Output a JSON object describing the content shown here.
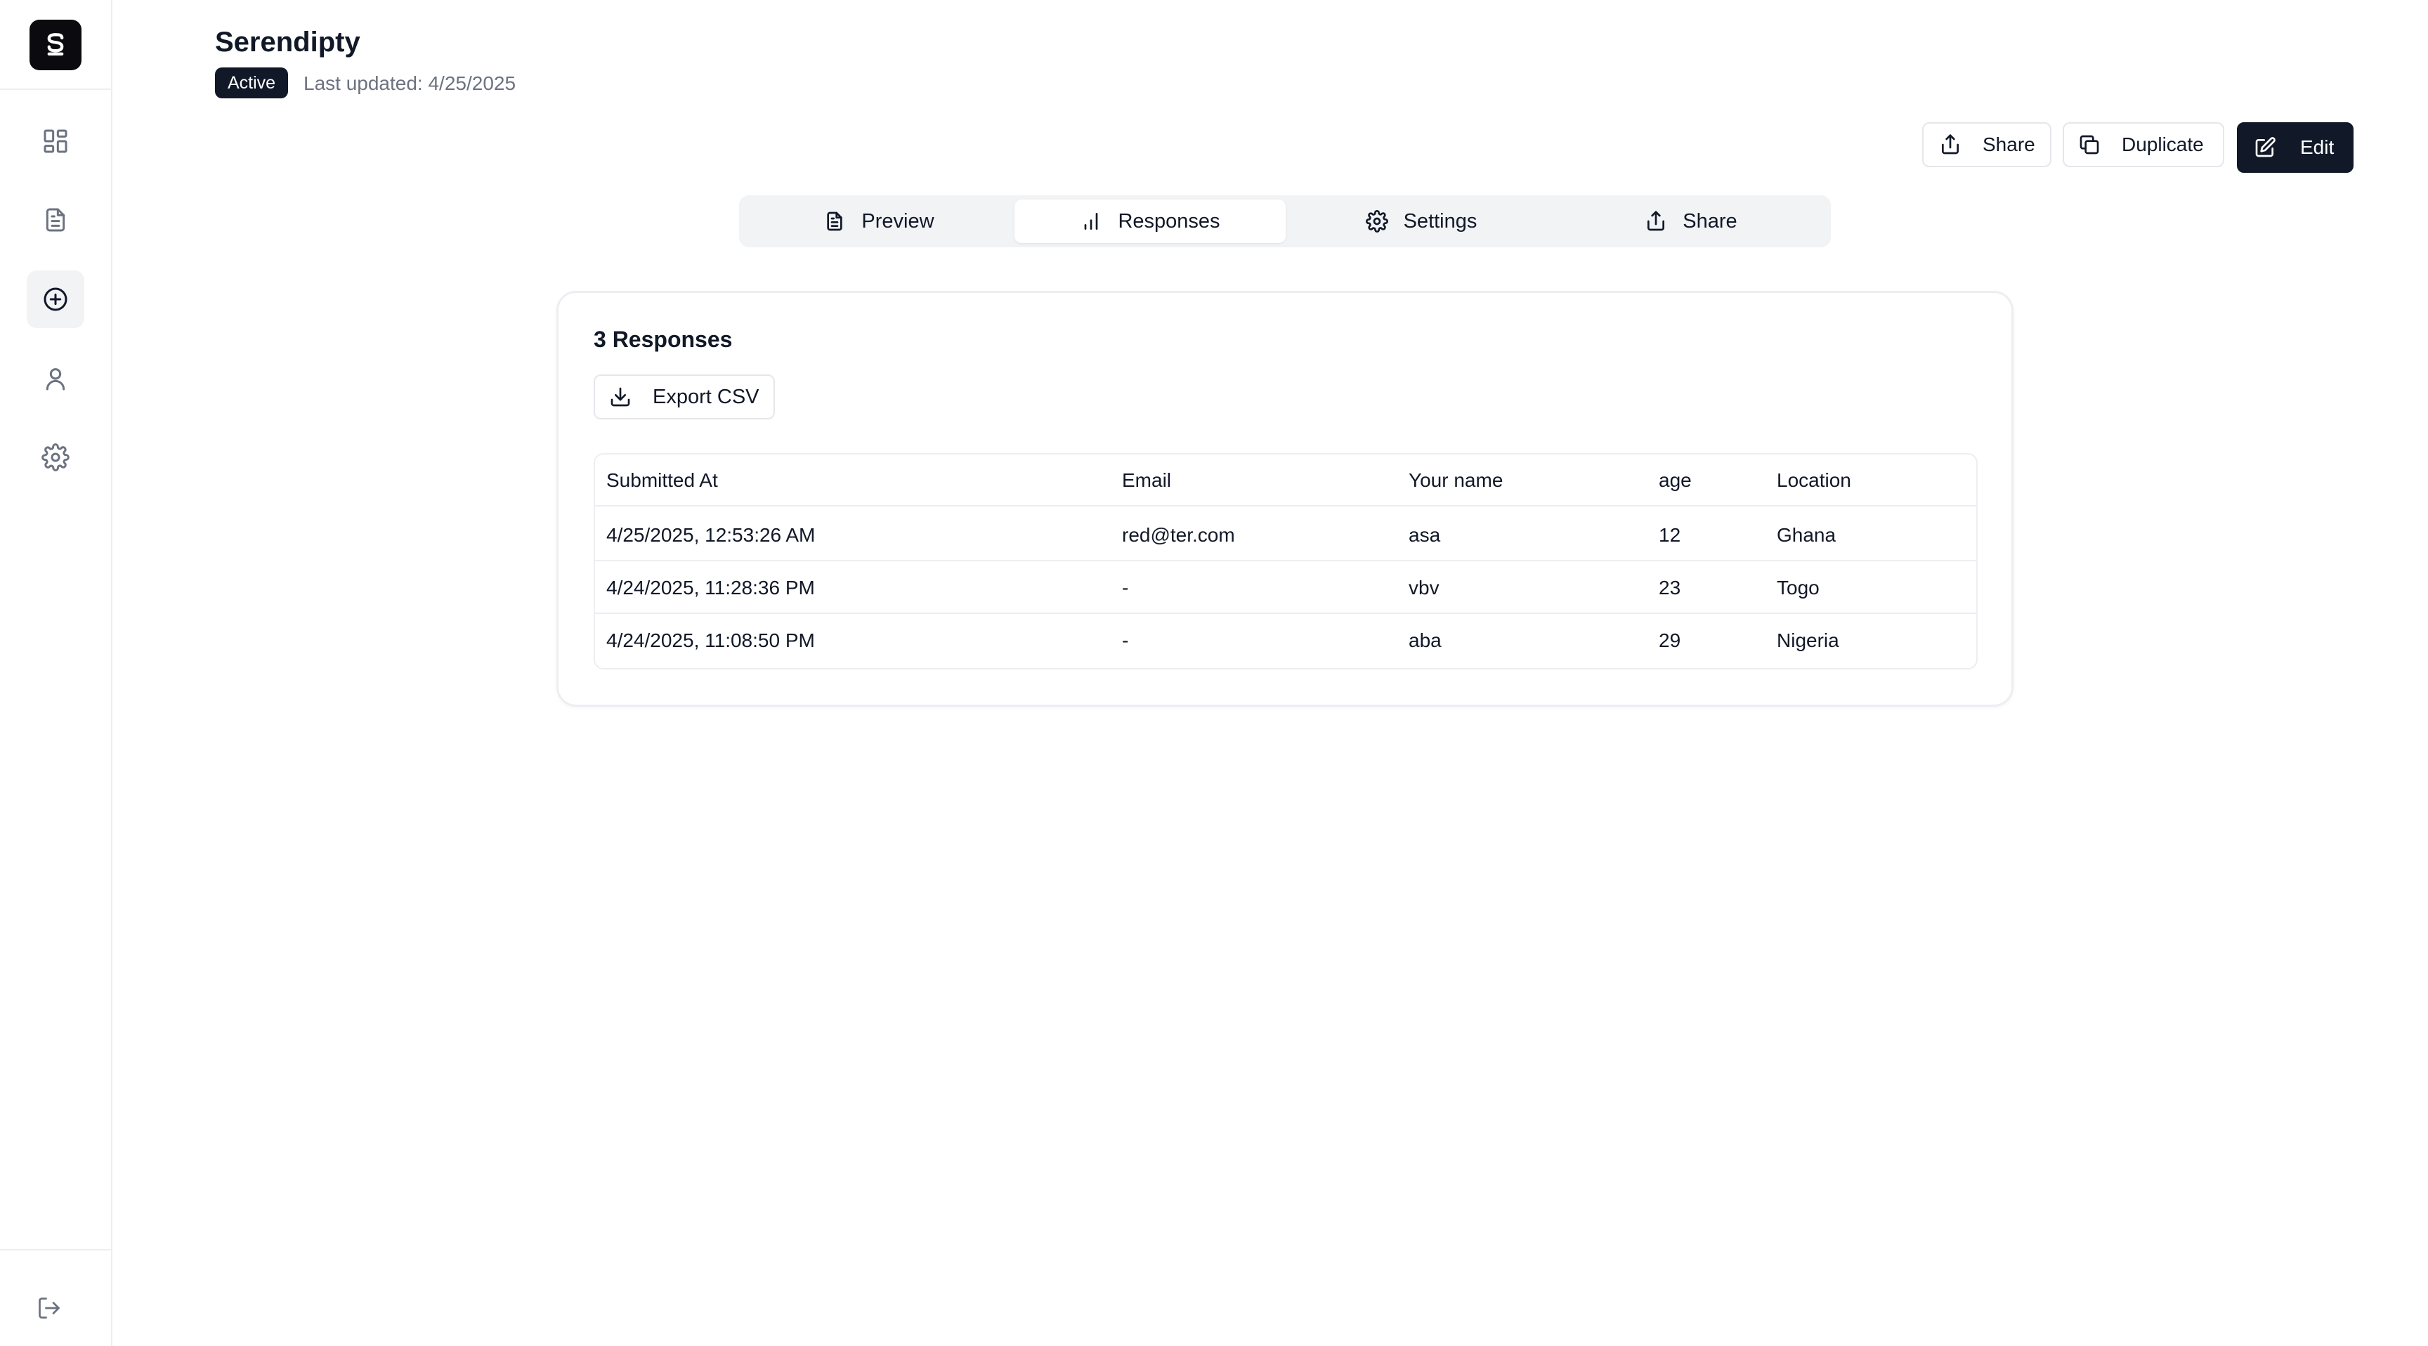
{
  "header": {
    "title": "Serendipty",
    "status": "Active",
    "last_updated": "Last updated: 4/25/2025"
  },
  "actions": {
    "share_label": "Share",
    "duplicate_label": "Duplicate",
    "edit_label": "Edit"
  },
  "tabs": [
    {
      "label": "Preview",
      "icon": "document-icon"
    },
    {
      "label": "Responses",
      "icon": "bar-chart-icon",
      "active": true
    },
    {
      "label": "Settings",
      "icon": "gear-icon"
    },
    {
      "label": "Share",
      "icon": "share-icon"
    }
  ],
  "responses": {
    "title": "3 Responses",
    "export_label": "Export CSV",
    "columns": [
      "Submitted At",
      "Email",
      "Your name",
      "age",
      "Location"
    ],
    "rows": [
      [
        "4/25/2025, 12:53:26 AM",
        "red@ter.com",
        "asa",
        "12",
        "Ghana"
      ],
      [
        "4/24/2025, 11:28:36 PM",
        "-",
        "vbv",
        "23",
        "Togo"
      ],
      [
        "4/24/2025, 11:08:50 PM",
        "-",
        "aba",
        "29",
        "Nigeria"
      ]
    ]
  },
  "sidebar": {
    "items": [
      "dashboard-icon",
      "file-icon",
      "plus-circle-icon",
      "user-icon",
      "gear-icon"
    ],
    "active_item": "plus-circle-icon",
    "footer_icon": "logout-icon"
  },
  "colors": {
    "primary": "#111827",
    "muted": "#6b7280",
    "border": "#eceef1",
    "tab_bg": "#f1f3f5"
  }
}
